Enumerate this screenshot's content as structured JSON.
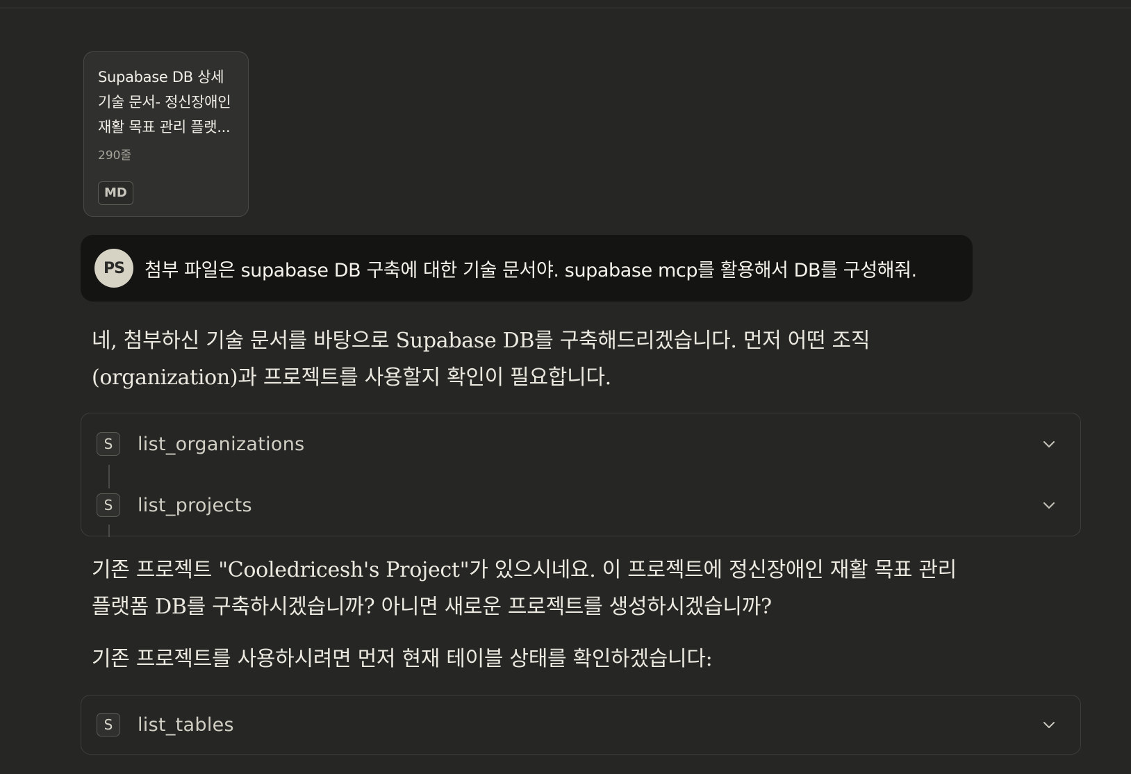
{
  "attachment": {
    "title": "Supabase DB 상세 기술 문서- 정신장애인 재활 목표 관리 플랫...",
    "lines": "290줄",
    "badge": "MD"
  },
  "user_message": {
    "avatar": "PS",
    "text": "첨부 파일은 supabase DB 구축에 대한 기술 문서야. supabase mcp를 활용해서 DB를 구성해줘."
  },
  "assistant": {
    "p1_line1": "네, 첨부하신 기술 문서를 바탕으로 Supabase DB를 구축해드리겠습니다. 먼저 어떤 조직",
    "p1_line2": "(organization)과 프로젝트를 사용할지 확인이 필요합니다.",
    "p2_line1": "기존 프로젝트 \"Cooledricesh's Project\"가 있으시네요. 이 프로젝트에 정신장애인 재활 목표 관리",
    "p2_line2": "플랫폼 DB를 구축하시겠습니까? 아니면 새로운 프로젝트를 생성하시겠습니까?",
    "p3": "기존 프로젝트를 사용하시려면 먼저 현재 테이블 상태를 확인하겠습니다:"
  },
  "tools": {
    "group1": [
      {
        "icon_letter": "S",
        "name": "list_organizations",
        "icon": "chevron-down-icon"
      },
      {
        "icon_letter": "S",
        "name": "list_projects",
        "icon": "chevron-down-icon"
      }
    ],
    "group2": [
      {
        "icon_letter": "S",
        "name": "list_tables",
        "icon": "chevron-down-icon"
      }
    ]
  },
  "colors": {
    "background": "#262624",
    "bubble": "#141413",
    "avatar": "#d6d2c4",
    "card": "#30302e"
  }
}
